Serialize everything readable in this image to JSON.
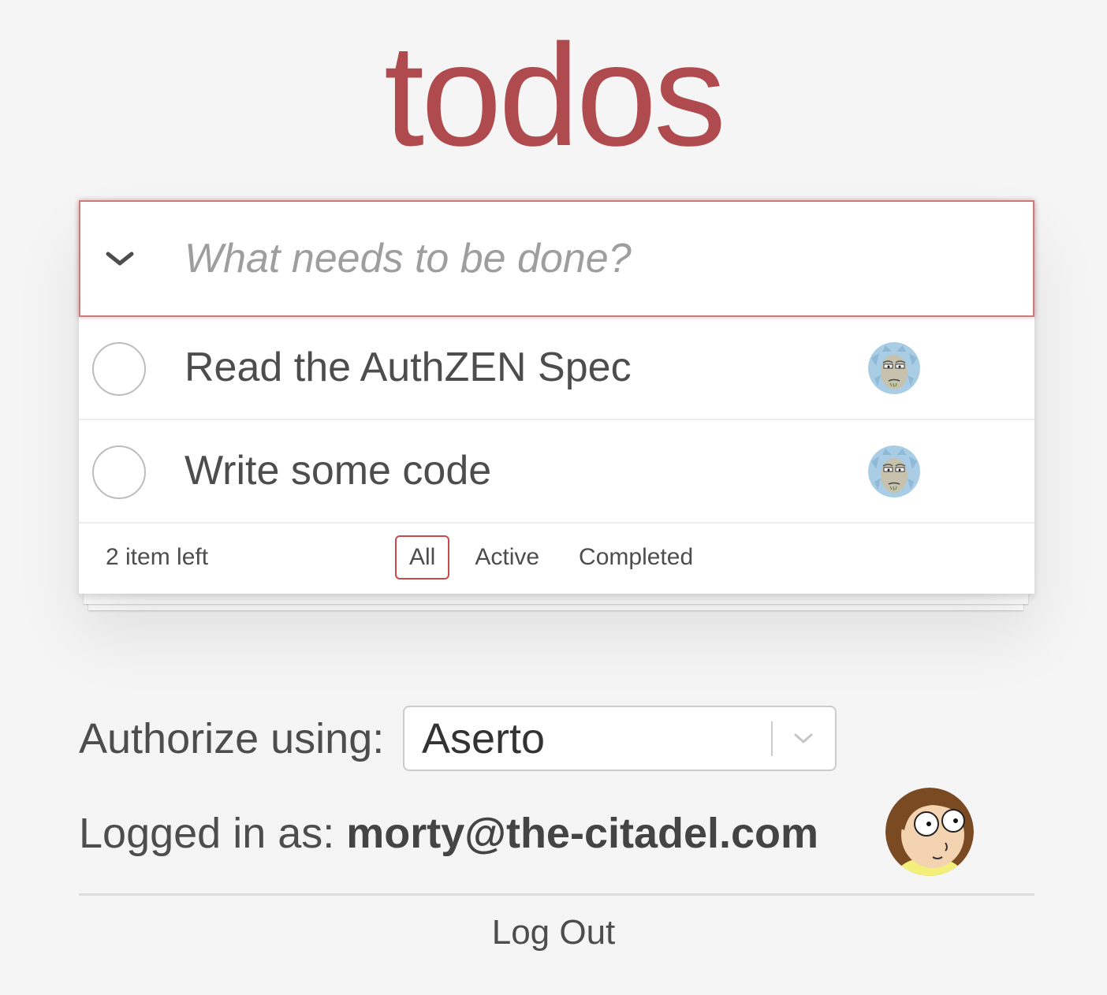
{
  "app": {
    "title": "todos",
    "brand_color": "#af4b4f"
  },
  "new_todo": {
    "placeholder": "What needs to be done?",
    "toggle_all_icon": "chevron-down-icon"
  },
  "todos": [
    {
      "label": "Read the AuthZEN Spec",
      "completed": false,
      "owner_avatar": "rick-avatar"
    },
    {
      "label": "Write some code",
      "completed": false,
      "owner_avatar": "rick-avatar"
    }
  ],
  "footer": {
    "count": "2 item left",
    "filters": [
      {
        "label": "All",
        "selected": true
      },
      {
        "label": "Active",
        "selected": false
      },
      {
        "label": "Completed",
        "selected": false
      }
    ]
  },
  "authorize": {
    "label": "Authorize using:",
    "selected": "Aserto",
    "arrow_icon": "chevron-down-icon"
  },
  "user": {
    "label": "Logged in as:",
    "email": "morty@the-citadel.com",
    "avatar": "morty-avatar"
  },
  "logout": {
    "label": "Log Out"
  }
}
